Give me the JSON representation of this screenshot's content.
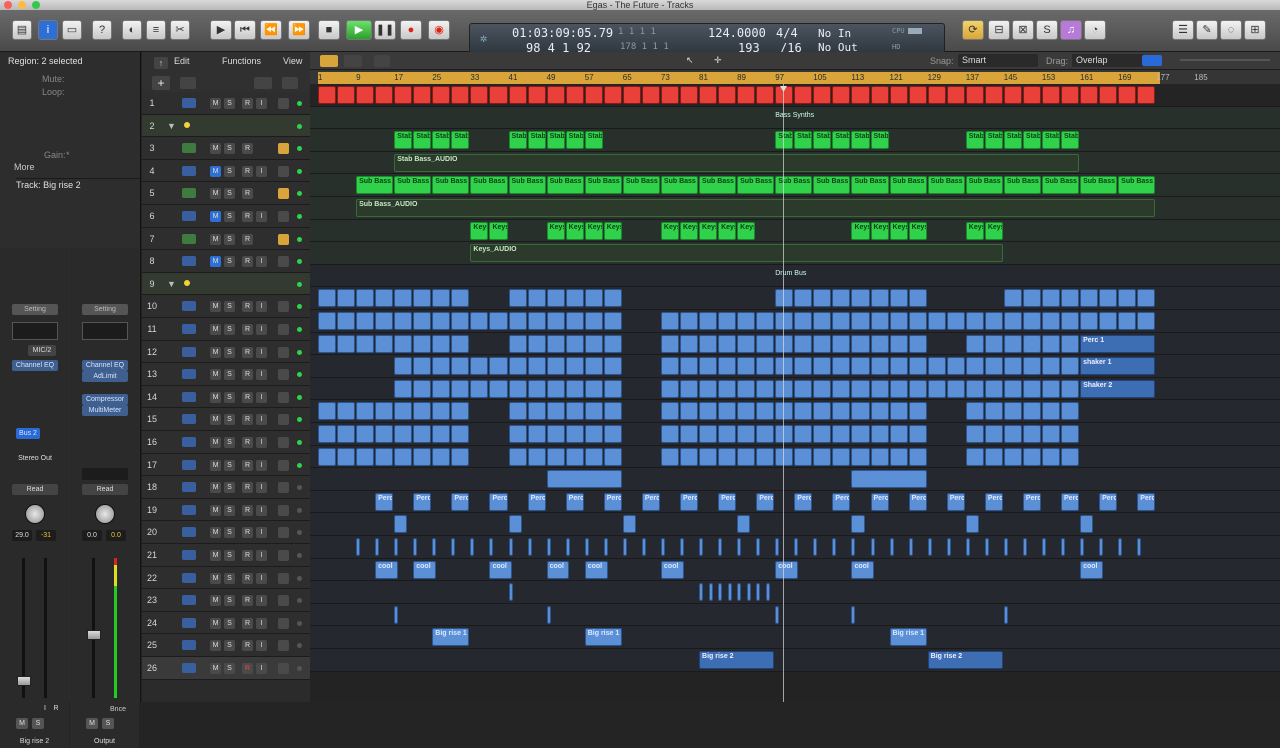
{
  "window": {
    "title": "Egas - The Future - Tracks"
  },
  "lcd": {
    "time": "01:03:09:05.79",
    "time_sub": "1  1  1  1",
    "bars": "98  4  1   92",
    "bars_sub": "178  1  1  1",
    "tempo": "124.0000",
    "tempo_sub": "193",
    "sig": "4/4",
    "sig_sub": "/16",
    "in": "No In",
    "out": "No Out",
    "cpu": "CPU",
    "hd": "HD"
  },
  "inspector": {
    "region": "Region: 2 selected",
    "mute": "Mute:",
    "loop": "Loop:",
    "gain": "Gain:",
    "gain_value": "*",
    "more": "More",
    "track": "Track:  Big rise 2",
    "strip1": {
      "setting": "Setting",
      "input": "MIC/2",
      "plugins": [
        "Channel EQ"
      ],
      "send": "Bus 2",
      "output": "Stereo Out",
      "automation": "Read",
      "pan": "29.0",
      "level": "-31",
      "name": "Big rise 2"
    },
    "strip2": {
      "setting": "Setting",
      "plugins": [
        "Channel EQ",
        "AdLimit",
        "Compressor",
        "MultiMeter"
      ],
      "automation": "Read",
      "pan": "0.0",
      "level": "0.0",
      "bnce": "Bnce",
      "name": "Output"
    },
    "m": "M",
    "s": "S",
    "i": "I",
    "r": "R"
  },
  "menus": {
    "edit": "Edit",
    "functions": "Functions",
    "view": "View",
    "snap_label": "Snap:",
    "snap": "Smart",
    "drag_label": "Drag:",
    "drag": "Overlap"
  },
  "ruler": [
    "1",
    "9",
    "17",
    "25",
    "33",
    "41",
    "49",
    "57",
    "65",
    "73",
    "81",
    "89",
    "97",
    "105",
    "113",
    "121",
    "129",
    "137",
    "145",
    "153",
    "161",
    "169",
    "177",
    "185"
  ],
  "buttons": {
    "mute": "M",
    "solo": "S",
    "rec": "R",
    "input": "I"
  },
  "tracks": [
    "1",
    "2",
    "3",
    "4",
    "5",
    "6",
    "7",
    "8",
    "9",
    "10",
    "11",
    "12",
    "13",
    "14",
    "15",
    "16",
    "17",
    "18",
    "19",
    "20",
    "21",
    "22",
    "23",
    "24",
    "25",
    "26"
  ],
  "labels": {
    "bass_synths": "Bass Synths",
    "drum_bus": "Drum Bus",
    "stab": "Stab",
    "stab_audio": "Stab Bass_AUDIO",
    "sub": "Sub Bass",
    "sub_audio": "Sub Bass_AUDIO",
    "keys": "Keys",
    "keys_audio": "Keys_AUDIO",
    "perc": "Perc",
    "perc1": "Perc 1",
    "shaker1": "shaker 1",
    "shaker2": "Shaker 2",
    "cool": "cool",
    "rise1": "Big rise 1",
    "rise2": "Big rise 2"
  },
  "colors": {
    "green": "#2fd24a",
    "red": "#e9413a",
    "blue": "#5b8fd6",
    "cycle": "#d9a53a"
  }
}
